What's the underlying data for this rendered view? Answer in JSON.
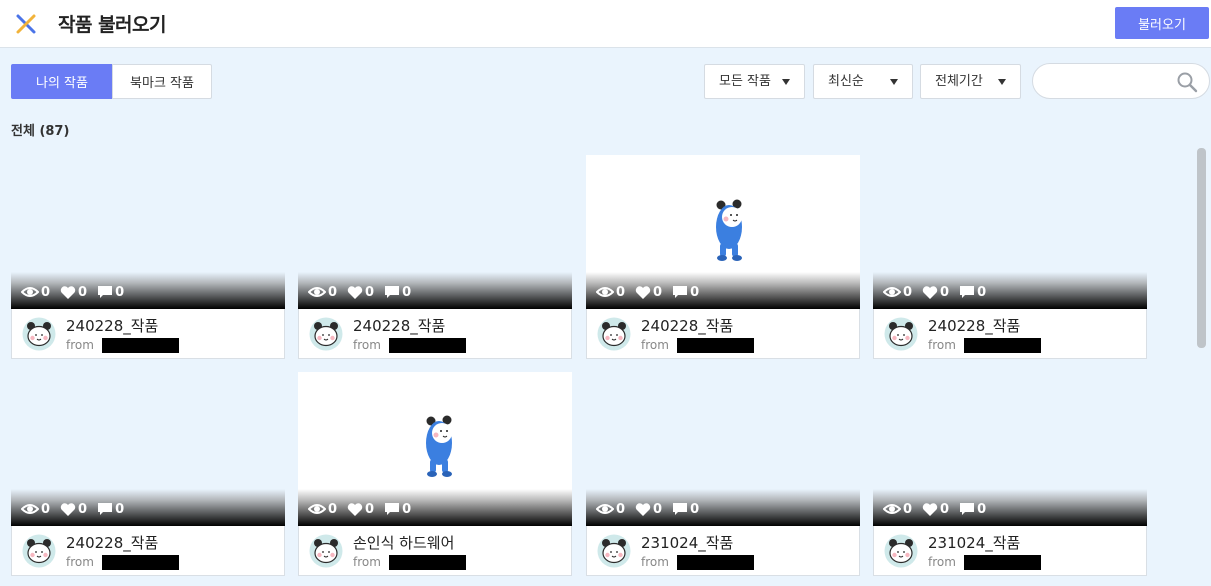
{
  "header": {
    "title": "작품 불러오기",
    "load_button": "불러오기"
  },
  "tabs": [
    {
      "label": "나의 작품",
      "active": true
    },
    {
      "label": "북마크 작품",
      "active": false
    }
  ],
  "filters": {
    "kind": "모든 작품",
    "sort": "최신순",
    "period": "전체기간"
  },
  "search": {
    "value": "",
    "placeholder": ""
  },
  "list": {
    "count_label": "전체 (87)"
  },
  "cards": [
    {
      "title": "240228_작품",
      "from": "from",
      "views": "0",
      "likes": "0",
      "comments": "0"
    },
    {
      "title": "240228_작품",
      "from": "from",
      "views": "0",
      "likes": "0",
      "comments": "0"
    },
    {
      "title": "240228_작품",
      "from": "from",
      "views": "0",
      "likes": "0",
      "comments": "0"
    },
    {
      "title": "240228_작품",
      "from": "from",
      "views": "0",
      "likes": "0",
      "comments": "0"
    },
    {
      "title": "240228_작품",
      "from": "from",
      "views": "0",
      "likes": "0",
      "comments": "0"
    },
    {
      "title": "손인식 하드웨어",
      "from": "from",
      "views": "0",
      "likes": "0",
      "comments": "0"
    },
    {
      "title": "231024_작품",
      "from": "from",
      "views": "0",
      "likes": "0",
      "comments": "0"
    },
    {
      "title": "231024_작품",
      "from": "from",
      "views": "0",
      "likes": "0",
      "comments": "0"
    }
  ],
  "colors": {
    "accent": "#6a7cf5",
    "background": "#eaf4fd",
    "character": "#3b7fe0"
  }
}
